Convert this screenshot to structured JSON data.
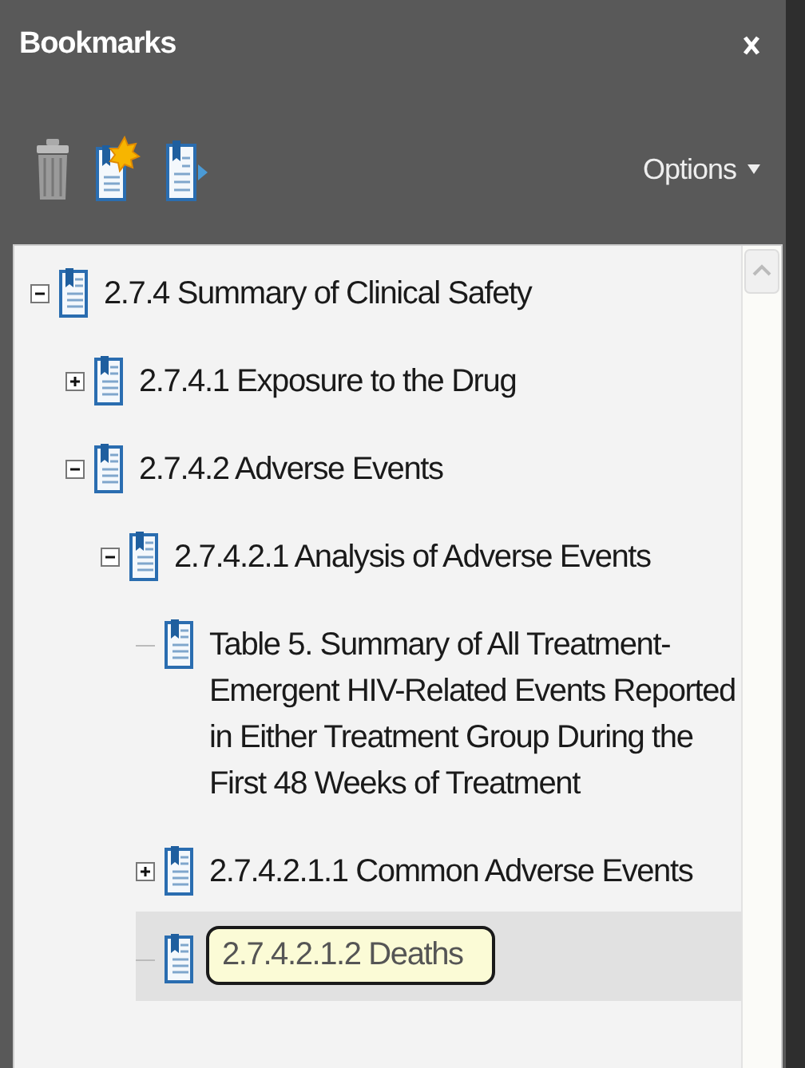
{
  "panel": {
    "title": "Bookmarks"
  },
  "toolbar": {
    "options_label": "Options"
  },
  "tree": [
    {
      "label": "2.7.4 Summary of Clinical Safety",
      "expanded": true,
      "selected": false,
      "children": [
        {
          "label": "2.7.4.1 Exposure to the Drug",
          "expanded": false,
          "selected": false
        },
        {
          "label": "2.7.4.2 Adverse Events",
          "expanded": true,
          "selected": false,
          "children": [
            {
              "label": "2.7.4.2.1 Analysis of Adverse Events",
              "expanded": true,
              "selected": false,
              "children": [
                {
                  "label": "Table 5. Summary of All Treatment-Emergent HIV-Related Events Reported in Either Treatment Group During the First 48 Weeks of Treatment",
                  "selected": false
                },
                {
                  "label": "2.7.4.2.1.1 Common Adverse Events",
                  "expanded": false,
                  "selected": false
                },
                {
                  "label": "2.7.4.2.1.2 Deaths",
                  "selected": true,
                  "tooltip": true
                }
              ]
            }
          ]
        }
      ]
    }
  ]
}
